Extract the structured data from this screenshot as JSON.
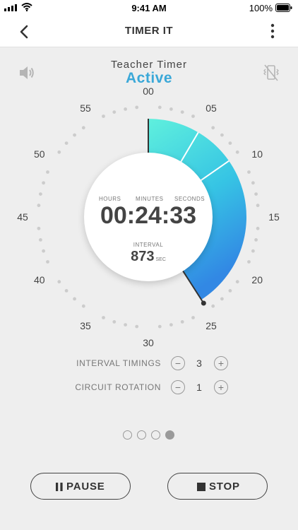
{
  "status_bar": {
    "time": "9:41 AM",
    "battery_percent": "100%"
  },
  "header": {
    "title": "TIMER IT"
  },
  "timer": {
    "name": "Teacher Timer",
    "state": "Active",
    "labels": {
      "hours": "HOURS",
      "minutes": "MINUTES",
      "seconds": "SECONDS"
    },
    "display": "00:24:33",
    "interval_label": "INTERVAL",
    "interval_value": "873",
    "interval_unit": "SEC"
  },
  "dial": {
    "marks": [
      "00",
      "05",
      "10",
      "15",
      "20",
      "25",
      "30",
      "35",
      "40",
      "45",
      "50",
      "55"
    ],
    "total_minutes": 60,
    "elapsed_minutes": 24.55,
    "segment_boundaries_minutes": [
      0,
      5.1,
      9.2,
      24.55
    ],
    "gradient_start": "#5ff0dd",
    "gradient_mid": "#36c4e4",
    "gradient_end": "#3288e4",
    "dot_color": "#cccccc"
  },
  "settings": {
    "interval_timings": {
      "label": "INTERVAL TIMINGS",
      "value": "3",
      "minus": "−",
      "plus": "+"
    },
    "circuit_rotation": {
      "label": "CIRCUIT ROTATION",
      "value": "1",
      "minus": "−",
      "plus": "+"
    }
  },
  "pager": {
    "count": 4,
    "active_index": 3
  },
  "controls": {
    "pause_label": "PAUSE",
    "stop_label": "STOP"
  },
  "colors": {
    "accent": "#3aa8d8"
  }
}
